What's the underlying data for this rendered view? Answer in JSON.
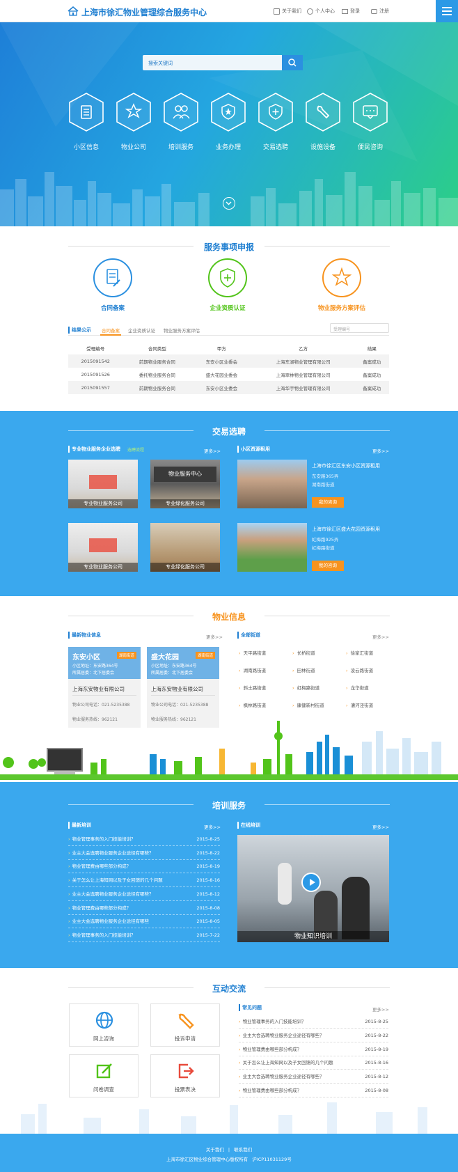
{
  "header": {
    "title": "上海市徐汇物业管理综合服务中心",
    "nav": [
      {
        "label": "关于我们",
        "icon": "building-icon"
      },
      {
        "label": "个人中心",
        "icon": "user-icon"
      },
      {
        "label": "登录",
        "icon": "monitor-icon"
      },
      {
        "label": "注册",
        "icon": "lock-icon"
      }
    ]
  },
  "hero": {
    "search_placeholder": "搜索关键词",
    "services": [
      "小区信息",
      "物业公司",
      "培训服务",
      "业务办理",
      "交易选聘",
      "设施设备",
      "便民咨询"
    ]
  },
  "declare": {
    "title": "服务事项申报",
    "items": [
      "合同备案",
      "企业资质认证",
      "物业服务方案评估"
    ],
    "tab_head": "结果公示",
    "tabs": [
      "合同备案",
      "企业资质认证",
      "物业服务方案评估"
    ],
    "search_placeholder": "受理编号",
    "columns": [
      "受理编号",
      "合同类型",
      "甲方",
      "乙方",
      "结果"
    ],
    "rows": [
      [
        "2015091542",
        "前期物业服务合同",
        "东安小区业委会",
        "上海东湖物业管理有限公司",
        "备案成功"
      ],
      [
        "2015091526",
        "委托物业服务合同",
        "盛大花园业委会",
        "上海翠林物业管理有限公司",
        "备案成功"
      ],
      [
        "2015091557",
        "前期物业服务合同",
        "东安小区业委会",
        "上海华宇物业管理有限公司",
        "备案成功"
      ]
    ]
  },
  "trade": {
    "title": "交易选聘",
    "left_head": "专业物业服务企业选聘",
    "left_badge": "选聘流程",
    "more": "更多>>",
    "right_head": "小区资源租用",
    "pics": [
      "专业物业服务公司",
      "专业绿化服务公司",
      "专业物业服务公司",
      "专业绿化服务公司"
    ],
    "rentals": [
      {
        "name": "上海市徐汇区东安小区资源租用",
        "addr": "东安路365弄",
        "street": "湖南路街道",
        "btn": "我的咨询"
      },
      {
        "name": "上海市徐汇区盛大花园资源租用",
        "addr": "虹梅路925弄",
        "street": "虹梅路街道",
        "btn": "我的咨询"
      }
    ]
  },
  "property": {
    "title": "物业信息",
    "left_head": "最新物业信息",
    "more": "更多>>",
    "right_head": "全部街道",
    "cards": [
      {
        "name": "东安小区",
        "tag": "湖南街道",
        "addr": "小区地址：东安路364号",
        "office": "所属居委：北下居委会",
        "company": "上海东安物业有限公司",
        "phone": "物业公司电话：021-5235388",
        "hotline": "物业服务热线：962121"
      },
      {
        "name": "盛大花园",
        "tag": "湖南街道",
        "addr": "小区地址：东安路364号",
        "office": "所属居委：北下居委会",
        "company": "上海东安物业有限公司",
        "phone": "物业公司电话：021-5235388",
        "hotline": "物业服务热线：962121"
      }
    ],
    "streets": [
      "天平路街道",
      "长桥街道",
      "徐家汇街道",
      "湖南路街道",
      "田林街道",
      "凌云路街道",
      "斜土路街道",
      "虹梅路街道",
      "龙华街道",
      "枫林路街道",
      "康健新村街道",
      "漕河泾街道"
    ]
  },
  "training": {
    "title": "培训服务",
    "left_head": "最新培训",
    "more": "更多>>",
    "right_head": "在线培训",
    "video_caption": "物业知识培训",
    "news": [
      [
        "物业管理事务的入门技能培训？",
        "2015-8-25"
      ],
      [
        "业主大会选聘物业服务企业途径有哪些？",
        "2015-8-22"
      ],
      [
        "物业管理费由哪些部分构成？",
        "2015-8-19"
      ],
      [
        "关于怎么让上海知网以及子女回馈的几个问题",
        "2015-8-16"
      ],
      [
        "业主大会选聘物业服务企业途径有哪些？",
        "2015-8-12"
      ],
      [
        "物业管理费由哪些部分构成？",
        "2015-8-08"
      ],
      [
        "业主大会选聘物业服务企业途径有哪些",
        "2015-8-05"
      ],
      [
        "物业管理事务的入门技能培训？",
        "2015-7-22"
      ]
    ]
  },
  "interact": {
    "title": "互动交流",
    "boxes": [
      {
        "label": "网上咨询",
        "icon": "globe-icon"
      },
      {
        "label": "投诉申请",
        "icon": "wrench-icon"
      },
      {
        "label": "问卷调查",
        "icon": "edit-icon"
      },
      {
        "label": "投票表决",
        "icon": "exit-icon"
      }
    ],
    "faq_head": "常见问题",
    "more": "更多>>",
    "faq": [
      [
        "物业管理事务的入门技能培训？",
        "2015-8-25"
      ],
      [
        "业主大会选聘物业服务企业途径有哪些？",
        "2015-8-22"
      ],
      [
        "物业管理费由哪些部分构成？",
        "2015-8-19"
      ],
      [
        "关于怎么让上海知网以及子女回馈的几个问题",
        "2015-8-16"
      ],
      [
        "业主大会选聘物业服务企业途径有哪些？",
        "2015-8-12"
      ],
      [
        "物业管理费由哪些部分构成？",
        "2015-8-08"
      ]
    ]
  },
  "footer": {
    "links": [
      "关于我们",
      "联系我们"
    ],
    "sep": "|",
    "copyright": "上海市徐汇区物业综合管理中心版权所有   沪ICP11031129号"
  },
  "colors": {
    "primary": "#2b99e6",
    "orange": "#f7931e",
    "green": "#52c41a",
    "section_blue": "#3aa8ee"
  }
}
